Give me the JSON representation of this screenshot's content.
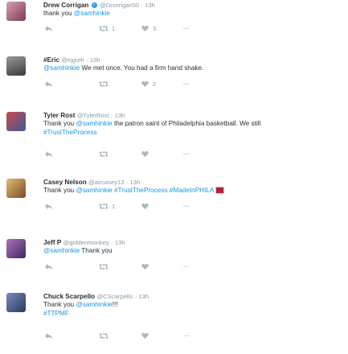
{
  "tweets": [
    {
      "name": "Drew Corrigan",
      "verified": true,
      "handle": "@Dcorrigan50",
      "time": "13h",
      "lines": [
        "thank you @samhinkie"
      ],
      "retweets": "1",
      "likes": "3",
      "avatar_color": "#8a5a6a"
    },
    {
      "name": "#Eric",
      "verified": false,
      "handle": "@ejguth",
      "time": "13h",
      "lines": [
        "@samhinkie We met once. You had a firm hand shake."
      ],
      "retweets": "",
      "likes": "2",
      "avatar_color": "#6b6b6b"
    },
    {
      "name": "Tyler Rost",
      "verified": false,
      "handle": "@TylerRost",
      "time": "13h",
      "lines": [
        "Thank you @samhinkie the patron saint of Philadelphia basketball. We still",
        "#TrustTheProcess"
      ],
      "retweets": "",
      "likes": "",
      "avatar_color": "#4a5a7a"
    },
    {
      "name": "Casey Nelson",
      "verified": false,
      "handle": "@aircasey13",
      "time": "13h",
      "lines": [
        "Thank you @samhinkie #TrustTheProcess #MadeInPHILA"
      ],
      "retweets": "1",
      "likes": "",
      "avatar_color": "#c9a05a"
    },
    {
      "name": "Jeff P",
      "verified": false,
      "handle": "@goldenmonkey",
      "time": "13h",
      "lines": [
        "@samhinkie Thank you"
      ],
      "retweets": "",
      "likes": "",
      "avatar_color": "#6a4a8a"
    },
    {
      "name": "Chuck Scarpello",
      "verified": false,
      "handle": "@CScarpello",
      "time": "13h",
      "lines": [
        "Thank you @samhinkie!!!",
        "#TTPMF"
      ],
      "retweets": "",
      "likes": "",
      "avatar_color": "#5a6a8a"
    }
  ],
  "icons": {
    "reply": "reply-icon",
    "retweet": "retweet-icon",
    "like": "heart-icon",
    "more": "more-icon"
  },
  "colors": {
    "link": "#1b95e0",
    "muted": "#8899a6",
    "icon": "#aab8c2"
  }
}
